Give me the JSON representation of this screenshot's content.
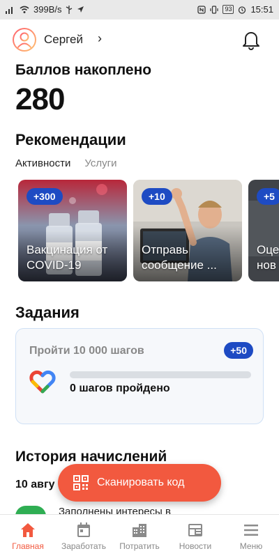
{
  "status_bar": {
    "network_speed": "399B/s",
    "battery": "93",
    "time": "15:51"
  },
  "header": {
    "user_name": "Сергей",
    "chevron": "›"
  },
  "points": {
    "label": "Баллов накоплено",
    "value": "280"
  },
  "recommendations": {
    "title": "Рекомендации",
    "tabs": [
      {
        "label": "Активности",
        "active": true
      },
      {
        "label": "Услуги",
        "active": false
      }
    ],
    "cards": [
      {
        "badge": "+300",
        "title": "Вакцинация от COVID-19"
      },
      {
        "badge": "+10",
        "title": "Отправь сообщение ..."
      },
      {
        "badge": "+5",
        "title": "Оце нов"
      }
    ]
  },
  "tasks": {
    "title": "Задания",
    "items": [
      {
        "name": "Пройти 10 000 шагов",
        "badge": "+50",
        "progress": 0,
        "status": "0 шагов пройдено",
        "icon": "google-fit-heart-icon"
      }
    ]
  },
  "history": {
    "title": "История начислений",
    "date": "10 авгу",
    "item_text": "Заполнены интересы в"
  },
  "fab": {
    "label": "Сканировать код",
    "icon": "qr-code-icon"
  },
  "bottom_nav": {
    "items": [
      {
        "label": "Главная",
        "icon": "home-icon",
        "active": true
      },
      {
        "label": "Заработать",
        "icon": "calendar-icon",
        "active": false
      },
      {
        "label": "Потратить",
        "icon": "buildings-icon",
        "active": false
      },
      {
        "label": "Новости",
        "icon": "news-icon",
        "active": false
      },
      {
        "label": "Меню",
        "icon": "menu-icon",
        "active": false
      }
    ]
  },
  "colors": {
    "accent": "#f2593f",
    "badge_blue": "#1e4bc3"
  }
}
